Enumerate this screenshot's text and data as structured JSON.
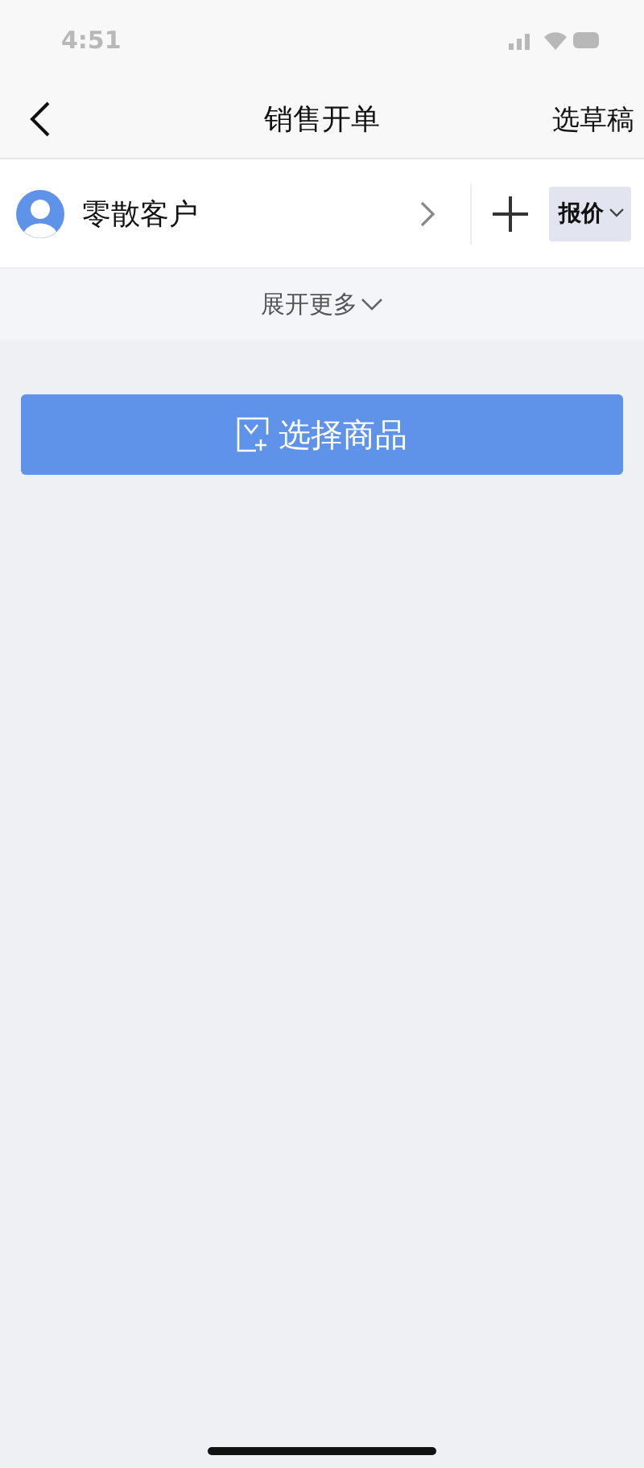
{
  "status_bar": {
    "time": "4:51"
  },
  "nav": {
    "title": "销售开单",
    "action": "选草稿"
  },
  "customer": {
    "name": "零散客户",
    "mode": "报价"
  },
  "expand": {
    "label": "展开更多"
  },
  "select_button": {
    "label": "选择商品"
  }
}
